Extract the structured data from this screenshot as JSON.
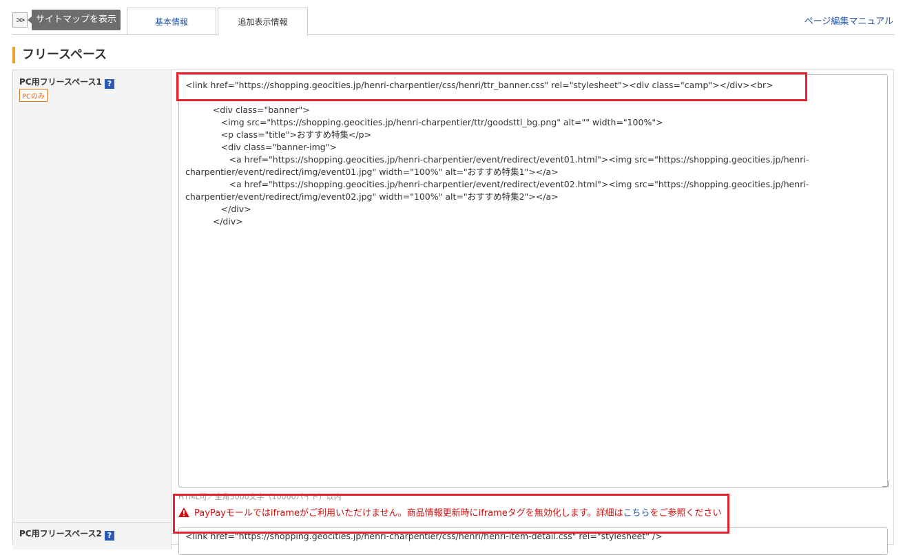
{
  "header": {
    "sitemap_toggle": ">>",
    "sitemap_tooltip": "サイトマップを表示",
    "tabs": [
      {
        "label": "基本情報"
      },
      {
        "label": "追加表示情報"
      }
    ],
    "manual_link": "ページ編集マニュアル"
  },
  "section": {
    "title": "フリースペース"
  },
  "fields": [
    {
      "label": "PC用フリースペース1",
      "help": "?",
      "badge": "PCのみ",
      "value": "<link href=\"https://shopping.geocities.jp/henri-charpentier/css/henri/ttr_banner.css\" rel=\"stylesheet\"><div class=\"camp\"></div><br>\n\n          <div class=\"banner\">\n             <img src=\"https://shopping.geocities.jp/henri-charpentier/ttr/goodsttl_bg.png\" alt=\"\" width=\"100%\">\n             <p class=\"title\">おすすめ特集</p>\n             <div class=\"banner-img\">\n                <a href=\"https://shopping.geocities.jp/henri-charpentier/event/redirect/event01.html\"><img src=\"https://shopping.geocities.jp/henri-charpentier/event/redirect/img/event01.jpg\" width=\"100%\" alt=\"おすすめ特集1\"></a>\n                <a href=\"https://shopping.geocities.jp/henri-charpentier/event/redirect/event02.html\"><img src=\"https://shopping.geocities.jp/henri-charpentier/event/redirect/img/event02.jpg\" width=\"100%\" alt=\"おすすめ特集2\"></a>\n             </div>\n          </div>",
      "hint": "HTML可／全角5000文字（10000バイト）以内",
      "warning_text": "PayPayモールではiframeがご利用いただけません。商品情報更新時にiframeタグを無効化します。詳細は",
      "warning_link": "こちら",
      "warning_suffix": "をご参照ください"
    },
    {
      "label": "PC用フリースペース2",
      "help": "?",
      "value": "<link href=\"https://shopping.geocities.jp/henri-charpentier/css/henri/henri-item-detail.css\" rel=\"stylesheet\" />"
    }
  ],
  "colors": {
    "accent": "#f0a030",
    "link": "#2456a6",
    "warning": "#d01010",
    "highlight": "#e8202e"
  }
}
